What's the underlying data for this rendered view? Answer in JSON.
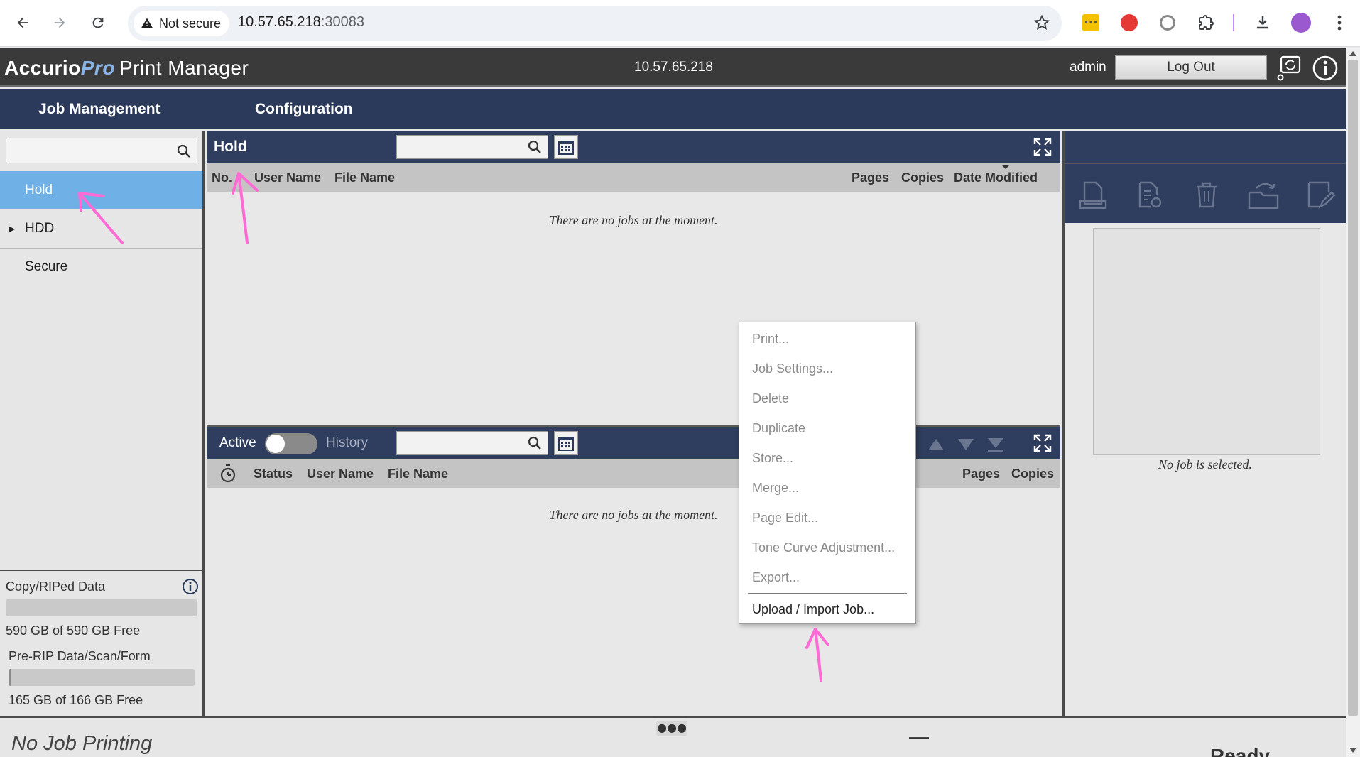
{
  "browser": {
    "security_label": "Not secure",
    "url_host": "10.57.65.218",
    "url_port": ":30083"
  },
  "header": {
    "logo_accurio": "Accurio",
    "logo_pro": "Pro",
    "logo_product": "Print Manager",
    "server_ip": "10.57.65.218",
    "user": "admin",
    "logout_label": "Log Out"
  },
  "nav": {
    "items": [
      {
        "label": "Job Management"
      },
      {
        "label": "Configuration"
      }
    ]
  },
  "sidebar": {
    "search_placeholder": "",
    "items": [
      {
        "label": "Hold",
        "selected": true
      },
      {
        "label": "HDD",
        "expandable": true
      },
      {
        "label": "Secure"
      }
    ],
    "storage": [
      {
        "label": "Copy/RIPed Data",
        "free_text": "590 GB of 590 GB Free",
        "used_fraction": 0.0
      },
      {
        "label": "Pre-RIP Data/Scan/Form",
        "free_text": "165 GB of 166 GB Free",
        "used_fraction": 0.006
      }
    ]
  },
  "hold_panel": {
    "title": "Hold",
    "search_value": "",
    "columns": [
      "No.",
      "User Name",
      "File Name",
      "Pages",
      "Copies",
      "Date Modified"
    ],
    "empty_message": "There are no jobs at the moment."
  },
  "active_panel": {
    "active_label": "Active",
    "history_label": "History",
    "search_value": "",
    "columns": [
      "Status",
      "User Name",
      "File Name",
      "Pages",
      "Copies"
    ],
    "empty_message": "There are no jobs at the moment."
  },
  "right_panel": {
    "no_job_message": "No job is selected."
  },
  "context_menu": {
    "items": [
      {
        "label": "Print...",
        "enabled": false
      },
      {
        "label": "Job Settings...",
        "enabled": false
      },
      {
        "label": "Delete",
        "enabled": false
      },
      {
        "label": "Duplicate",
        "enabled": false
      },
      {
        "label": "Store...",
        "enabled": false
      },
      {
        "label": "Merge...",
        "enabled": false
      },
      {
        "label": "Page Edit...",
        "enabled": false
      },
      {
        "label": "Tone Curve Adjustment...",
        "enabled": false
      },
      {
        "label": "Export...",
        "enabled": false
      },
      {
        "label": "Upload / Import Job...",
        "enabled": true
      }
    ]
  },
  "status_bar": {
    "printing_status": "No Job Printing",
    "dash": "—",
    "ready": "Ready",
    "handle": "●●●"
  },
  "colors": {
    "header_bg": "#3a3a3a",
    "nav_bg": "#2b3a5a",
    "panel_header_bg": "#2f3d5e",
    "selected_item": "#6fb0e6",
    "annotation": "#ff6ad5"
  }
}
